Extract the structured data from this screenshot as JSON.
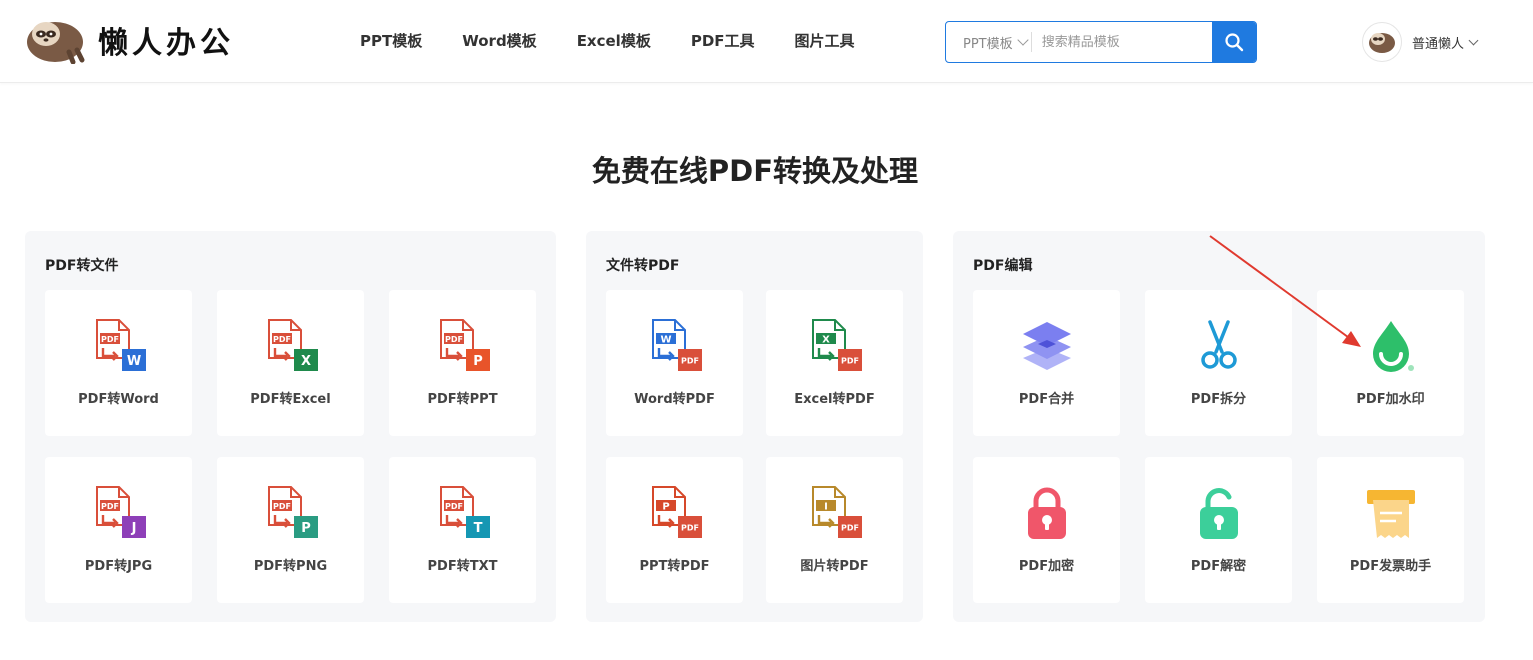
{
  "header": {
    "logo_text": "懒人办公",
    "nav": [
      "PPT模板",
      "Word模板",
      "Excel模板",
      "PDF工具",
      "图片工具"
    ],
    "search": {
      "category": "PPT模板",
      "placeholder": "搜索精品模板"
    },
    "user_name": "普通懒人"
  },
  "main": {
    "title": "免费在线PDF转换及处理",
    "panels": [
      {
        "title": "PDF转文件",
        "cards": [
          {
            "label": "PDF转Word",
            "icon": "pdf-to-word-icon",
            "badge": "W",
            "color": "#2b6fd6"
          },
          {
            "label": "PDF转Excel",
            "icon": "pdf-to-excel-icon",
            "badge": "X",
            "color": "#1f8a4c"
          },
          {
            "label": "PDF转PPT",
            "icon": "pdf-to-ppt-icon",
            "badge": "P",
            "color": "#e8542a"
          },
          {
            "label": "PDF转JPG",
            "icon": "pdf-to-jpg-icon",
            "badge": "J",
            "color": "#8e3fb8"
          },
          {
            "label": "PDF转PNG",
            "icon": "pdf-to-png-icon",
            "badge": "P",
            "color": "#2a9c82"
          },
          {
            "label": "PDF转TXT",
            "icon": "pdf-to-txt-icon",
            "badge": "T",
            "color": "#1597b3"
          }
        ]
      },
      {
        "title": "文件转PDF",
        "cards": [
          {
            "label": "Word转PDF",
            "icon": "word-to-pdf-icon",
            "badge": "W",
            "color": "#2b6fd6"
          },
          {
            "label": "Excel转PDF",
            "icon": "excel-to-pdf-icon",
            "badge": "X",
            "color": "#1f8a4c"
          },
          {
            "label": "PPT转PDF",
            "icon": "ppt-to-pdf-icon",
            "badge": "P",
            "color": "#d6482a"
          },
          {
            "label": "图片转PDF",
            "icon": "image-to-pdf-icon",
            "badge": "I",
            "color": "#b8892b"
          }
        ]
      },
      {
        "title": "PDF编辑",
        "cards": [
          {
            "label": "PDF合并",
            "icon": "layers-merge-icon",
            "color": "#7b7ff0"
          },
          {
            "label": "PDF拆分",
            "icon": "scissors-icon",
            "color": "#1e9ad6"
          },
          {
            "label": "PDF加水印",
            "icon": "water-drop-icon",
            "color": "#2dbf6a"
          },
          {
            "label": "PDF加密",
            "icon": "lock-icon",
            "color": "#f0566a"
          },
          {
            "label": "PDF解密",
            "icon": "unlock-icon",
            "color": "#3ccf9a"
          },
          {
            "label": "PDF发票助手",
            "icon": "invoice-icon",
            "color": "#f6b632"
          }
        ]
      }
    ]
  },
  "colors": {
    "accent": "#1f7ae0",
    "pdf_red": "#d94f3a",
    "annotation_arrow": "#e03a2f"
  }
}
